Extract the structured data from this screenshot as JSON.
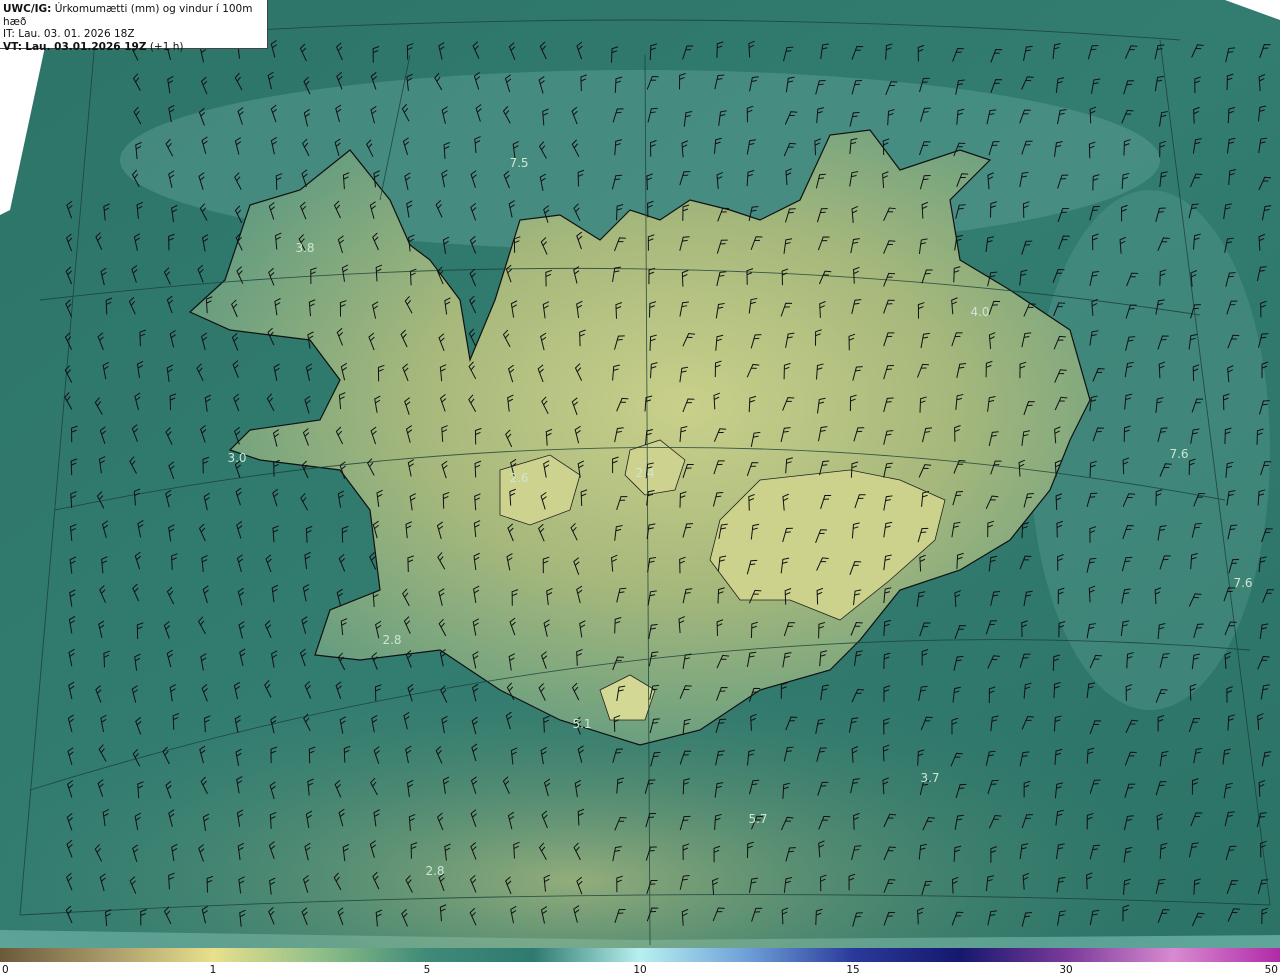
{
  "header": {
    "model": "UWC/IG:",
    "title": "Úrkomumætti (mm) og vindur í 100m hæð",
    "it_line": "IT: Lau. 03. 01. 2026 18Z",
    "vt_prefix": "VT:",
    "vt_time": "Lau. 03.01.2026 19Z",
    "vt_offset": "(+1 h)"
  },
  "map_values": [
    {
      "text": "7.5"
    },
    {
      "text": "3.8"
    },
    {
      "text": "4.0"
    },
    {
      "text": "7.6"
    },
    {
      "text": "3.0"
    },
    {
      "text": "2.6"
    },
    {
      "text": "2.4"
    },
    {
      "text": "7.6"
    },
    {
      "text": "2.8"
    },
    {
      "text": "5.1"
    },
    {
      "text": "3.7"
    },
    {
      "text": "5.7"
    },
    {
      "text": "2.8"
    }
  ],
  "colorbar": {
    "ticks": [
      "0",
      "1",
      "5",
      "10",
      "15",
      "30",
      "50"
    ],
    "colors": [
      "#6b5a3a",
      "#a89a6a",
      "#e8e08c",
      "#8fbf88",
      "#3f8a78",
      "#2f7a70",
      "#b8f0f0",
      "#6ea0d8",
      "#2a3a9a",
      "#15186e",
      "#7a3a9a",
      "#d88ad0",
      "#b02aa8"
    ]
  },
  "colors": {
    "sea": "#2f7a70",
    "land_low": "#8ca873",
    "land_high": "#c9d08a",
    "coast": "#111111"
  }
}
